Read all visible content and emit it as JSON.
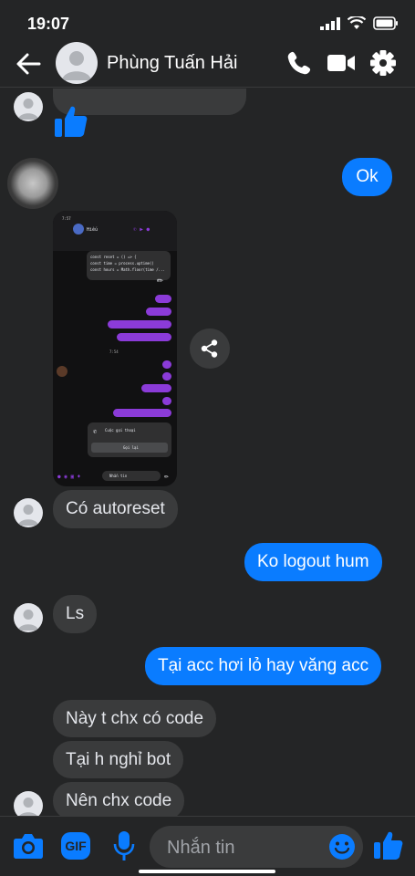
{
  "status_bar": {
    "time": "19:07"
  },
  "header": {
    "contact_name": "Phùng Tuấn Hải"
  },
  "messages": {
    "reply_ok": "Ok",
    "m_autoreset": "Có autoreset",
    "m_ko_logout": "Ko logout hum",
    "m_ls": "Ls",
    "m_tai_acc": "Tại acc hơi lỏ hay văng acc",
    "m_nay_t": "Này t chx có code",
    "m_tai_h": "Tại h nghỉ bot",
    "m_nen_chx": "Nên chx code"
  },
  "screenshot": {
    "contact": "Hiếu",
    "code_lines": [
      "const reset = () => {",
      "const time = process.uptime()",
      "const hours = Math.floor(time /..."
    ],
    "time_label": "7:54",
    "call_title": "Cuộc gọi thoại",
    "call_button": "Gọi lại",
    "input_placeholder": "Nhắn tin"
  },
  "composer": {
    "placeholder": "Nhắn tin",
    "gif_label": "GIF"
  },
  "colors": {
    "background": "#242526",
    "incoming": "#3a3b3c",
    "outgoing": "#0a7cff",
    "accent": "#0a7cff"
  }
}
